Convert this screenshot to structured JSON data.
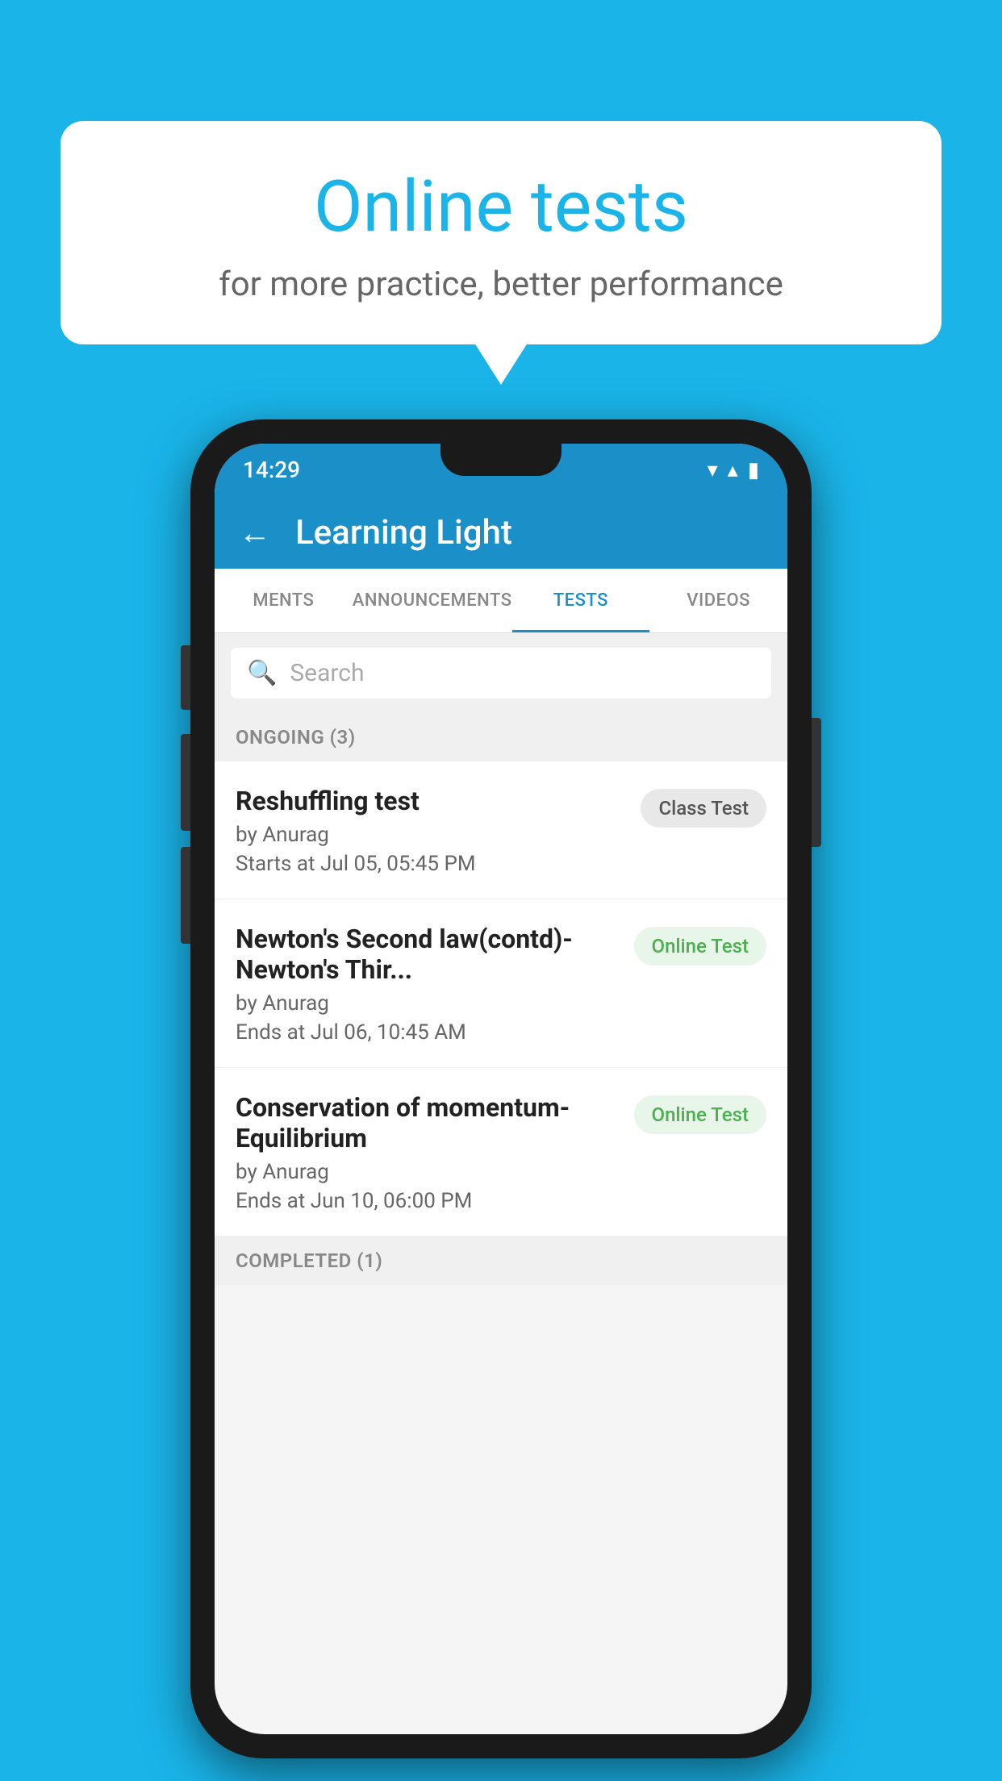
{
  "background_color": "#1ab4e8",
  "speech_bubble": {
    "title": "Online tests",
    "subtitle": "for more practice, better performance"
  },
  "phone": {
    "status_bar": {
      "time": "14:29",
      "wifi": "▼",
      "signal": "▲",
      "battery": "▐"
    },
    "header": {
      "title": "Learning Light",
      "back_label": "←"
    },
    "tabs": [
      {
        "label": "MENTS",
        "active": false
      },
      {
        "label": "ANNOUNCEMENTS",
        "active": false
      },
      {
        "label": "TESTS",
        "active": true
      },
      {
        "label": "VIDEOS",
        "active": false
      }
    ],
    "search": {
      "placeholder": "Search"
    },
    "sections": [
      {
        "header": "ONGOING (3)",
        "tests": [
          {
            "name": "Reshuffling test",
            "author": "by Anurag",
            "time_label": "Starts at",
            "time": "Jul 05, 05:45 PM",
            "badge": "Class Test",
            "badge_type": "class"
          },
          {
            "name": "Newton's Second law(contd)-Newton's Thir...",
            "author": "by Anurag",
            "time_label": "Ends at",
            "time": "Jul 06, 10:45 AM",
            "badge": "Online Test",
            "badge_type": "online"
          },
          {
            "name": "Conservation of momentum-Equilibrium",
            "author": "by Anurag",
            "time_label": "Ends at",
            "time": "Jun 10, 06:00 PM",
            "badge": "Online Test",
            "badge_type": "online"
          }
        ]
      }
    ],
    "completed_header": "COMPLETED (1)"
  }
}
